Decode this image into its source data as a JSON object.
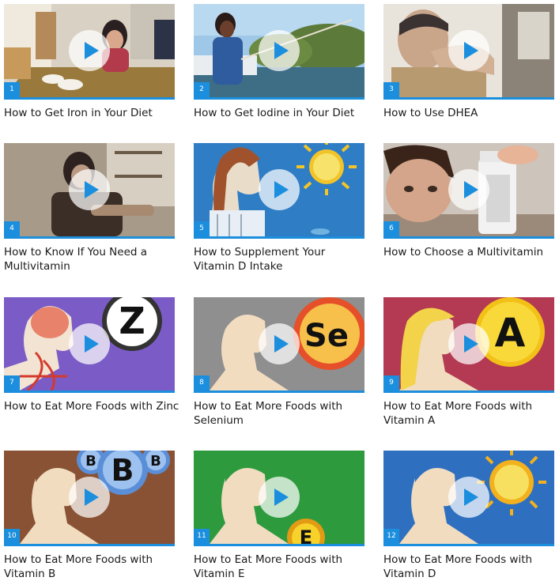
{
  "videos": [
    {
      "number": "1",
      "title": "How to Get Iron in Your Diet"
    },
    {
      "number": "2",
      "title": "How to Get Iodine in Your Diet"
    },
    {
      "number": "3",
      "title": "How to Use DHEA"
    },
    {
      "number": "4",
      "title": "How to Know If You Need a Multivitamin"
    },
    {
      "number": "5",
      "title": "How to Supplement Your Vitamin D Intake"
    },
    {
      "number": "6",
      "title": "How to Choose a Multivitamin"
    },
    {
      "number": "7",
      "title": "How to Eat More Foods with Zinc",
      "badge": "Z"
    },
    {
      "number": "8",
      "title": "How to Eat More Foods with Selenium",
      "badge": "Se"
    },
    {
      "number": "9",
      "title": "How to Eat More Foods with Vitamin A",
      "badge": "A"
    },
    {
      "number": "10",
      "title": "How to Eat More Foods with Vitamin B",
      "badge": "B"
    },
    {
      "number": "11",
      "title": "How to Eat More Foods with Vitamin E",
      "badge": "E"
    },
    {
      "number": "12",
      "title": "How to Eat More Foods with Vitamin D"
    }
  ],
  "colors": {
    "accent": "#1b8fdd"
  },
  "icons": {
    "play": "play-icon"
  }
}
